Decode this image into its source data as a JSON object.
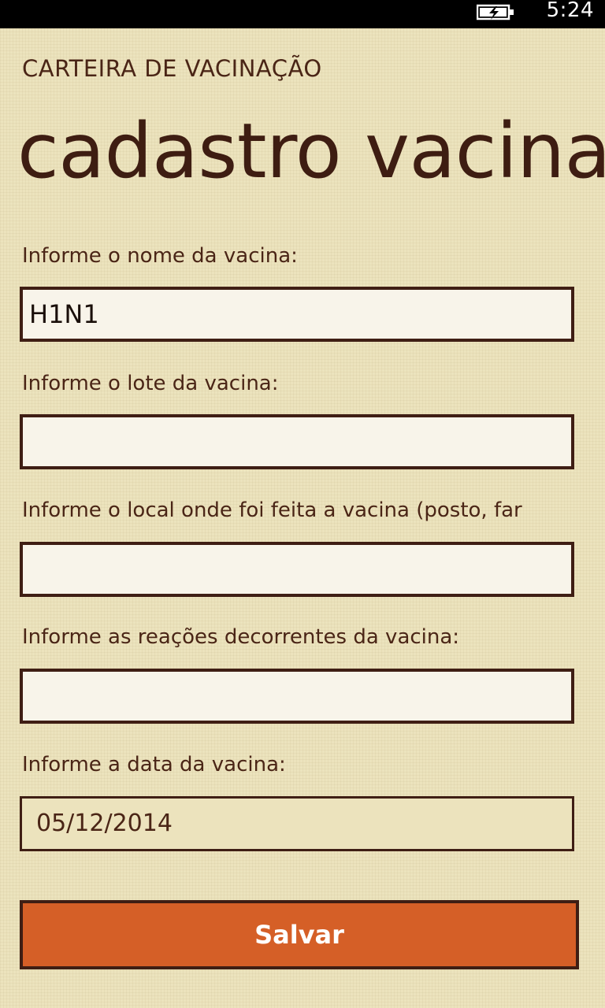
{
  "status_bar": {
    "time": "5:24",
    "battery_icon": "battery-charging-icon"
  },
  "header": {
    "app_title": "CARTEIRA DE VACINAÇÃO",
    "page_title": "cadastro vacina"
  },
  "form": {
    "nome": {
      "label": "Informe o nome da vacina:",
      "value": "H1N1"
    },
    "lote": {
      "label": "Informe o lote da vacina:",
      "value": ""
    },
    "local": {
      "label": "Informe o local onde foi feita a vacina (posto, far",
      "value": ""
    },
    "reacoes": {
      "label": "Informe as reações decorrentes da vacina:",
      "value": ""
    },
    "data": {
      "label": "Informe a data da vacina:",
      "value": "05/12/2014"
    },
    "save_label": "Salvar"
  },
  "colors": {
    "background": "#ece3bd",
    "text": "#4a2516",
    "accent": "#d55f27",
    "border": "#3f1e14"
  }
}
